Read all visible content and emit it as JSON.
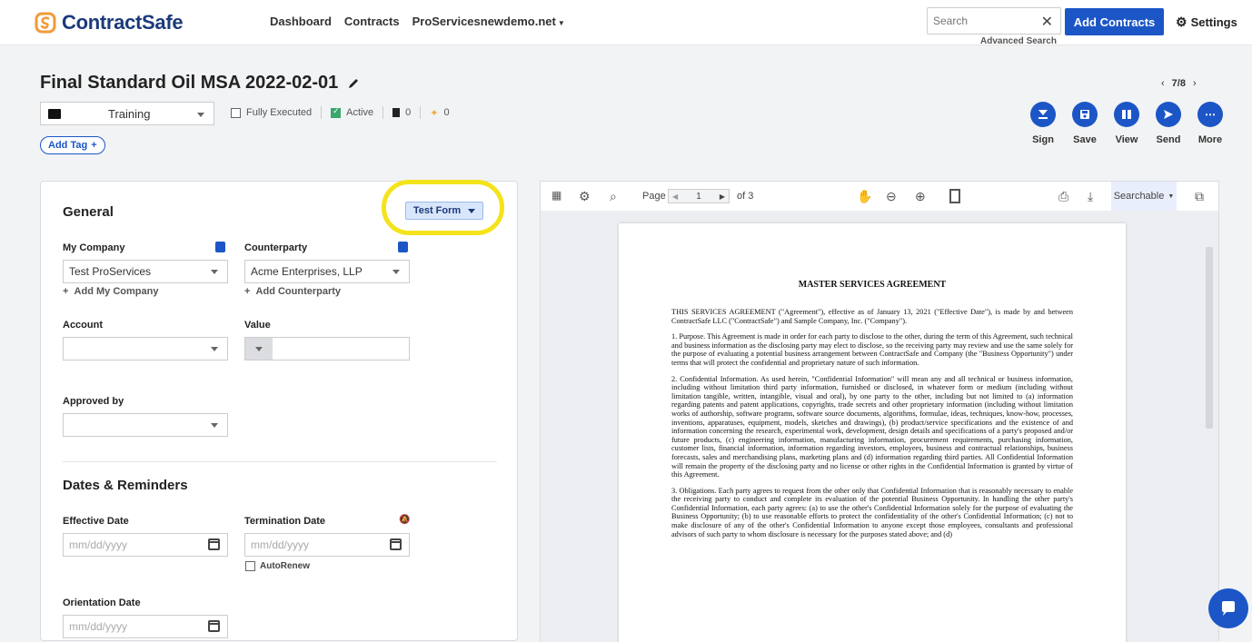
{
  "brand": {
    "name": "ContractSafe",
    "accent": "#1c56c6",
    "logo_color": "#f29a38"
  },
  "nav": {
    "items": [
      "Dashboard",
      "Contracts",
      "ProServicesnewdemo.net"
    ]
  },
  "search": {
    "placeholder": "Search",
    "advanced": "Advanced Search"
  },
  "header": {
    "add_contracts": "Add Contracts",
    "settings": "Settings"
  },
  "contract": {
    "title": "Final Standard Oil MSA 2022-02-01",
    "pager": "7/8",
    "folder": "Training",
    "fully_executed": "Fully Executed",
    "active": "Active",
    "docs_count": "0",
    "pins_count": "0",
    "add_tag": "Add Tag"
  },
  "actions": [
    {
      "label": "Sign",
      "icon": "sign-icon"
    },
    {
      "label": "Save",
      "icon": "save-icon"
    },
    {
      "label": "View",
      "icon": "view-icon"
    },
    {
      "label": "Send",
      "icon": "send-icon"
    },
    {
      "label": "More",
      "icon": "more-icon"
    }
  ],
  "form": {
    "form_select": "Test Form",
    "general": "General",
    "my_company_label": "My Company",
    "my_company_value": "Test ProServices",
    "add_my_company": "Add My Company",
    "counterparty_label": "Counterparty",
    "counterparty_value": "Acme Enterprises, LLP",
    "add_counterparty": "Add Counterparty",
    "account_label": "Account",
    "value_label": "Value",
    "approved_label": "Approved by",
    "dates_title": "Dates & Reminders",
    "effective_label": "Effective Date",
    "termination_label": "Termination Date",
    "date_placeholder": "mm/dd/yyyy",
    "autorenew": "AutoRenew",
    "orientation_label": "Orientation Date"
  },
  "viewer": {
    "page_label": "Page",
    "page_current": "1",
    "page_of": "of 3",
    "mode": "Searchable"
  },
  "document": {
    "title": "MASTER SERVICES AGREEMENT",
    "intro": "THIS SERVICES AGREEMENT (\"Agreement\"), effective as of January 13, 2021 (\"Effective Date\"), is made by and between ContractSafe LLC (\"ContractSafe\") and Sample Company, Inc. (\"Company\").",
    "p1": "1.      Purpose. This Agreement is made in order for each party to disclose to the other, during the term of this Agreement, such technical and business information as the disclosing party may elect to disclose, so the receiving party may review and use the same solely for the purpose of evaluating a potential business arrangement between ContractSafe and Company (the \"Business Opportunity\") under terms that will protect the confidential and proprietary nature of such information.",
    "p2": "2.      Confidential Information. As used herein, \"Confidential Information\" will mean any and all technical or business information, including without limitation third party information, furnished or disclosed, in whatever form or medium (including without limitation tangible, written, intangible, visual and oral), by one party to the other, including but not limited to (a) information regarding patents and patent applications, copyrights, trade secrets and other proprietary information (including without limitation works of authorship, software programs, software source documents, algorithms, formulae, ideas, techniques, know-how, processes, inventions, apparatuses, equipment, models, sketches and drawings), (b) product/service specifications and the existence of and information concerning the research, experimental work, development, design details and specifications of a party's proposed and/or future products, (c) engineering information, manufacturing information, procurement requirements, purchasing information, customer lists, financial information, information regarding investors, employees, business and contractual relationships, business forecasts, sales and merchandising plans, marketing plans and (d) information regarding third parties. All Confidential Information will remain the property of the disclosing party and no license or other rights in the Confidential Information is granted by virtue of this Agreement.",
    "p3": "3.      Obligations. Each party agrees to request from the other only that Confidential Information that is reasonably necessary to enable the receiving party to conduct and complete its evaluation of the potential Business Opportunity. In handling the other party's Confidential Information, each party agrees: (a) to use the other's Confidential Information solely for the purpose of evaluating the Business Opportunity; (b) to use reasonable efforts to protect the confidentiality of the other's Confidential Information; (c) not to make disclosure of any of the other's Confidential Information to anyone except those employees, consultants and professional advisors of such party to whom disclosure is necessary for the purposes stated above; and (d)"
  }
}
